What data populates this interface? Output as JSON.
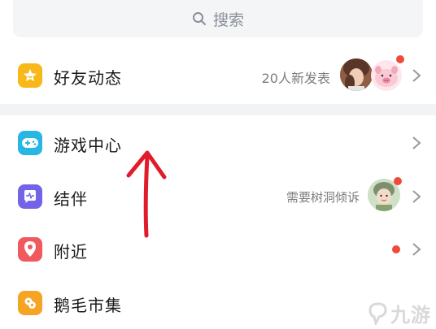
{
  "search": {
    "placeholder": "搜索"
  },
  "rows": [
    {
      "label": "好友动态",
      "right_text": "20人新发表",
      "icon": "star-icon",
      "color": "#f8b81a"
    },
    {
      "label": "游戏中心",
      "icon": "gamepad-icon",
      "color": "#27b7e3"
    },
    {
      "label": "结伴",
      "right_text": "需要树洞倾诉",
      "icon": "chat-pulse-icon",
      "color": "#7363e8"
    },
    {
      "label": "附近",
      "icon": "location-pin-icon",
      "color": "#f05a5e"
    },
    {
      "label": "鹅毛市集",
      "icon": "market-icon",
      "color": "#f6a423"
    }
  ],
  "watermark": {
    "text": "九游"
  },
  "colors": {
    "badge": "#f04a3a",
    "arrow": "#e01b2a",
    "separator": "#f2f3f5"
  }
}
